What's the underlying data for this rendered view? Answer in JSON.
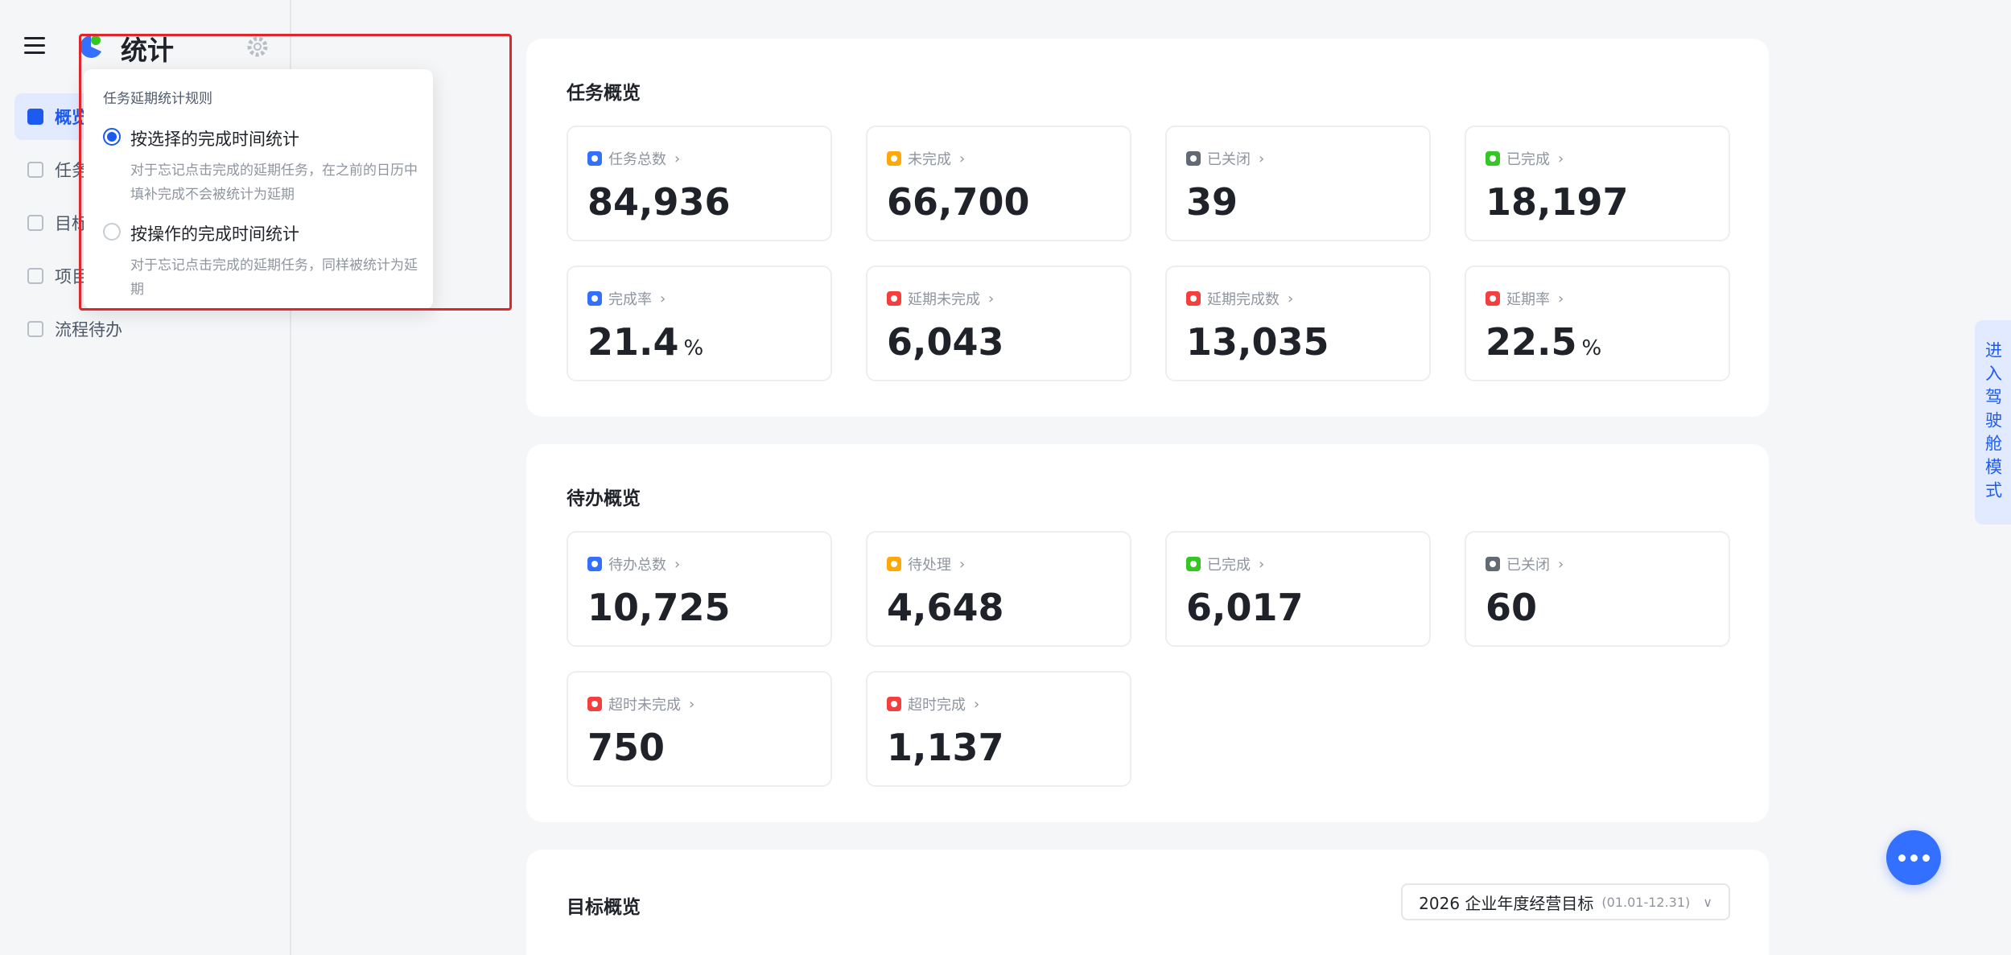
{
  "app": {
    "title": "统计"
  },
  "sidebar": {
    "items": [
      {
        "label": "概览",
        "active": true
      },
      {
        "label": "任务"
      },
      {
        "label": "目标"
      },
      {
        "label": "项目"
      },
      {
        "label": "流程待办"
      }
    ]
  },
  "popover": {
    "title": "任务延期统计规则",
    "options": [
      {
        "label": "按选择的完成时间统计",
        "desc": "对于忘记点击完成的延期任务，在之前的日历中填补完成不会被统计为延期",
        "checked": true
      },
      {
        "label": "按操作的完成时间统计",
        "desc": "对于忘记点击完成的延期任务，同样被统计为延期",
        "checked": false
      }
    ]
  },
  "tasks": {
    "title": "任务概览",
    "stats": [
      {
        "label": "任务总数",
        "value": "84,936",
        "color": "#3370ff"
      },
      {
        "label": "未完成",
        "value": "66,700",
        "color": "#ffa80b"
      },
      {
        "label": "已关闭",
        "value": "39",
        "color": "#646a73"
      },
      {
        "label": "已完成",
        "value": "18,197",
        "color": "#34c724"
      },
      {
        "label": "完成率",
        "value": "21.4",
        "unit": "%",
        "color": "#3370ff"
      },
      {
        "label": "延期未完成",
        "value": "6,043",
        "color": "#f53f3f"
      },
      {
        "label": "延期完成数",
        "value": "13,035",
        "color": "#f53f3f"
      },
      {
        "label": "延期率",
        "value": "22.5",
        "unit": "%",
        "color": "#f53f3f"
      }
    ]
  },
  "todos": {
    "title": "待办概览",
    "stats": [
      {
        "label": "待办总数",
        "value": "10,725",
        "color": "#3370ff"
      },
      {
        "label": "待处理",
        "value": "4,648",
        "color": "#ffa80b"
      },
      {
        "label": "已完成",
        "value": "6,017",
        "color": "#34c724"
      },
      {
        "label": "已关闭",
        "value": "60",
        "color": "#646a73"
      },
      {
        "label": "超时未完成",
        "value": "750",
        "color": "#f53f3f"
      },
      {
        "label": "超时完成",
        "value": "1,137",
        "color": "#f53f3f"
      }
    ]
  },
  "goals": {
    "title": "目标概览",
    "selector": {
      "value": "2026 企业年度经营目标",
      "range": "(01.01-12.31)"
    }
  },
  "side_tab": {
    "label": "进入驾驶舱模式"
  }
}
